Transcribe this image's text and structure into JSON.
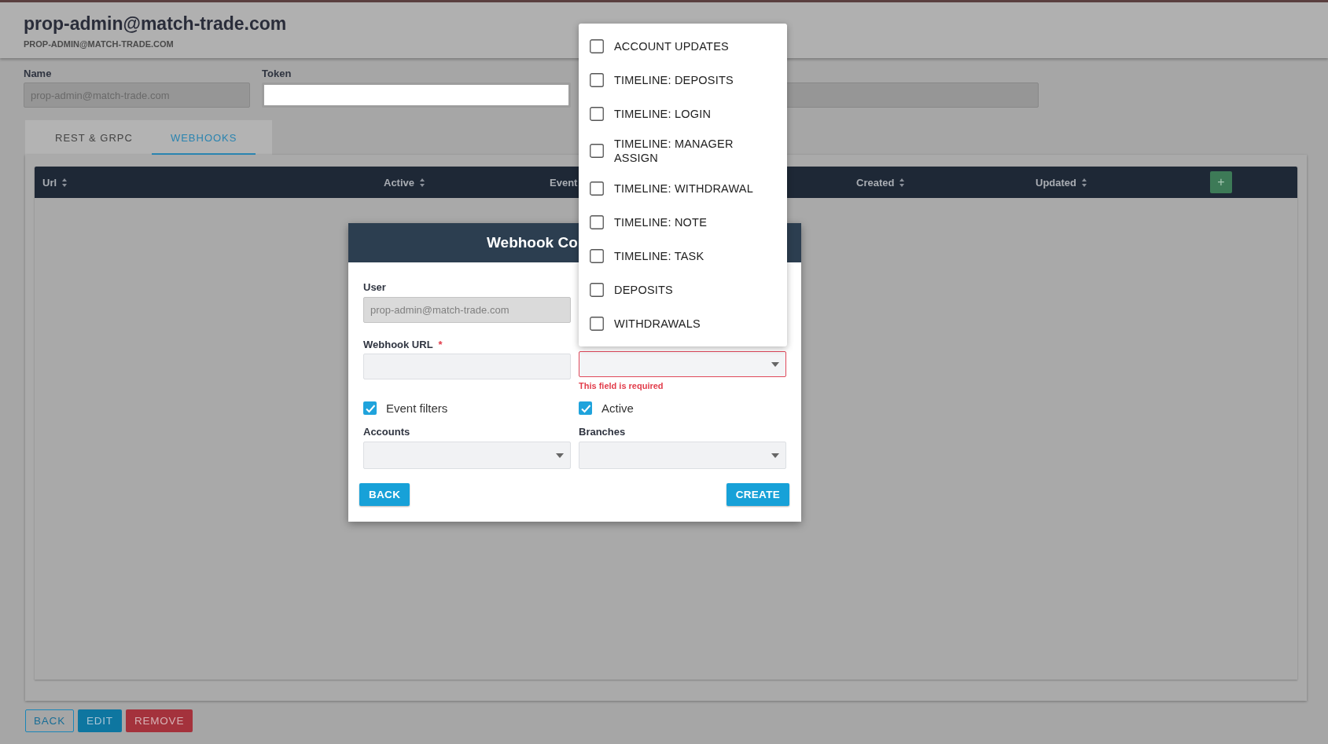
{
  "header": {
    "title": "prop-admin@match-trade.com",
    "subtitle": "PROP-ADMIN@MATCH-TRADE.COM"
  },
  "fields": [
    {
      "kind": "readonly",
      "label": "Name",
      "value": "prop-admin@match-trade.com"
    },
    {
      "kind": "text",
      "label": "Token"
    },
    {
      "kind": "readonly"
    }
  ],
  "tabs": [
    {
      "label": "REST & GRPC",
      "selected": false
    },
    {
      "label": "WEBHOOKS",
      "selected": true
    }
  ],
  "table": {
    "columns": [
      {
        "label": "Url",
        "sortable": true
      },
      {
        "label": "Active",
        "sortable": true
      },
      {
        "label": "Event",
        "sortable": false
      },
      {
        "label": "Created",
        "sortable": true
      },
      {
        "label": "Updated",
        "sortable": true
      }
    ],
    "add_button": "+"
  },
  "dialog": {
    "title": "Webhook Co",
    "user": {
      "label": "User",
      "value": "prop-admin@match-trade.com"
    },
    "url": {
      "label": "Webhook URL",
      "required_mark": "*"
    },
    "type_select": {
      "invalid": true,
      "error": "This field is required"
    },
    "checks": [
      {
        "label": "Event filters",
        "checked": true
      },
      {
        "label": "Active",
        "checked": true
      }
    ],
    "selects": [
      {
        "label": "Accounts"
      },
      {
        "label": "Branches"
      }
    ],
    "buttons": [
      "BACK",
      "CREATE"
    ]
  },
  "dropdown": {
    "options": [
      {
        "label": "ACCOUNT UPDATES",
        "checked": false
      },
      {
        "label": "TIMELINE: DEPOSITS",
        "checked": false
      },
      {
        "label": "TIMELINE: LOGIN",
        "checked": false
      },
      {
        "label": "TIMELINE: MANAGER ASSIGN",
        "checked": false
      },
      {
        "label": "TIMELINE: WITHDRAWAL",
        "checked": false
      },
      {
        "label": "TIMELINE: NOTE",
        "checked": false
      },
      {
        "label": "TIMELINE: TASK",
        "checked": false
      },
      {
        "label": "DEPOSITS",
        "checked": false
      },
      {
        "label": "WITHDRAWALS",
        "checked": false
      }
    ]
  },
  "footer_buttons": [
    {
      "label": "BACK",
      "kind": "outline"
    },
    {
      "label": "EDIT",
      "kind": "primary"
    },
    {
      "label": "REMOVE",
      "kind": "danger"
    }
  ]
}
